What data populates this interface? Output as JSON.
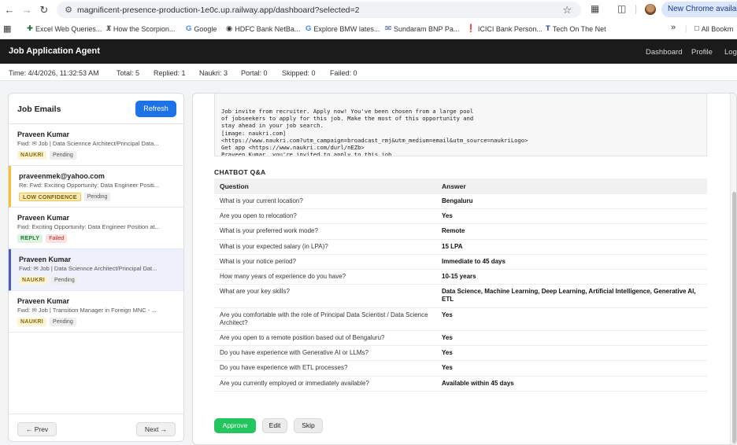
{
  "browser": {
    "url": "magnificent-presence-production-1e0c.up.railway.app/dashboard?selected=2",
    "chrome_notice": "New Chrome available",
    "bookmarks": [
      {
        "label": "Excel Web Queries...",
        "icon": "excel-icon"
      },
      {
        "label": "How the Scorpion...",
        "icon": "nyt-icon"
      },
      {
        "label": "Google",
        "icon": "google-icon"
      },
      {
        "label": "HDFC Bank NetBa...",
        "icon": "hdfc-icon"
      },
      {
        "label": "Explore BMW lates...",
        "icon": "google-icon"
      },
      {
        "label": "Sundaram BNP Pa...",
        "icon": "mail-icon"
      },
      {
        "label": "ICICI Bank Person...",
        "icon": "icici-icon"
      },
      {
        "label": "Tech On The Net",
        "icon": "tech-icon"
      }
    ],
    "more_bookmarks": "»",
    "all_bookmarks": "All Bookm"
  },
  "app": {
    "title": "Job Application Agent",
    "nav": [
      "Dashboard",
      "Profile",
      "Log"
    ]
  },
  "status": {
    "time": "Time: 4/4/2026, 11:32:53 AM",
    "total": "Total: 5",
    "replied": "Replied: 1",
    "naukri": "Naukri: 3",
    "portal": "Portal: 0",
    "skipped": "Skipped: 0",
    "failed": "Failed: 0"
  },
  "sidebar": {
    "title": "Job Emails",
    "refresh": "Refresh",
    "prev": "← Prev",
    "next": "Next →",
    "emails": [
      {
        "from": "Praveen Kumar",
        "subject": "Fwd: ✉ Job | Data Sciennce Architect/Principal Data...",
        "badges": [
          "NAUKRI",
          "Pending"
        ]
      },
      {
        "from": "praveenmek@yahoo.com",
        "subject": "Re: Fwd: Exciting Opportunity: Data Engineer Positi...",
        "badges": [
          "LOW CONFIDENCE",
          "Pending"
        ]
      },
      {
        "from": "Praveen Kumar",
        "subject": "Fwd: Exciting Opportunity: Data Engineer Position at...",
        "badges": [
          "REPLY",
          "Failed"
        ]
      },
      {
        "from": "Praveen Kumar",
        "subject": "Fwd: ✉ Job | Data Sciennce Architect/Principal Dat...",
        "badges": [
          "NAUKRI",
          "Pending"
        ]
      },
      {
        "from": "Praveen Kumar",
        "subject": "Fwd: ✉ Job | Transition Manager in Foreign MNC - ...",
        "badges": [
          "NAUKRI",
          "Pending"
        ]
      }
    ]
  },
  "detail": {
    "email_body": "Job invite from recruiter. Apply now! You've been chosen from a large pool\nof jobseekers to apply for this job. Make the most of this opportunity and\nstay ahead in your job search.\n[image: naukri.com]\n<https://www.naukri.com?utm_campaign=broadcast_rmj&utm_medium=email&utm_source=naukriLogo>\nGet app <https://www.naukri.com/durl/nEZb>\nPraveen Kumar, you're invited to apply to this job",
    "qa_title": "CHATBOT Q&A",
    "qa_headers": [
      "Question",
      "Answer"
    ],
    "qa_rows": [
      [
        "What is your current location?",
        "Bengaluru"
      ],
      [
        "Are you open to relocation?",
        "Yes"
      ],
      [
        "What is your preferred work mode?",
        "Remote"
      ],
      [
        "What is your expected salary (in LPA)?",
        "15 LPA"
      ],
      [
        "What is your notice period?",
        "Immediate to 45 days"
      ],
      [
        "How many years of experience do you have?",
        "10-15 years"
      ],
      [
        "What are your key skills?",
        "Data Science, Machine Learning, Deep Learning, Artificial Intelligence, Generative AI, ETL"
      ],
      [
        "Are you comfortable with the role of Principal Data Scientist / Data Science Architect?",
        "Yes"
      ],
      [
        "Are you open to a remote position based out of Bengaluru?",
        "Yes"
      ],
      [
        "Do you have experience with Generative AI or LLMs?",
        "Yes"
      ],
      [
        "Do you have experience with ETL processes?",
        "Yes"
      ],
      [
        "Are you currently employed or immediately available?",
        "Available within 45 days"
      ]
    ],
    "approve": "Approve",
    "edit": "Edit",
    "skip": "Skip"
  },
  "colors": {
    "accent": "#1d72e8",
    "approve": "#22c55e",
    "appbar": "#1b1b1b"
  }
}
